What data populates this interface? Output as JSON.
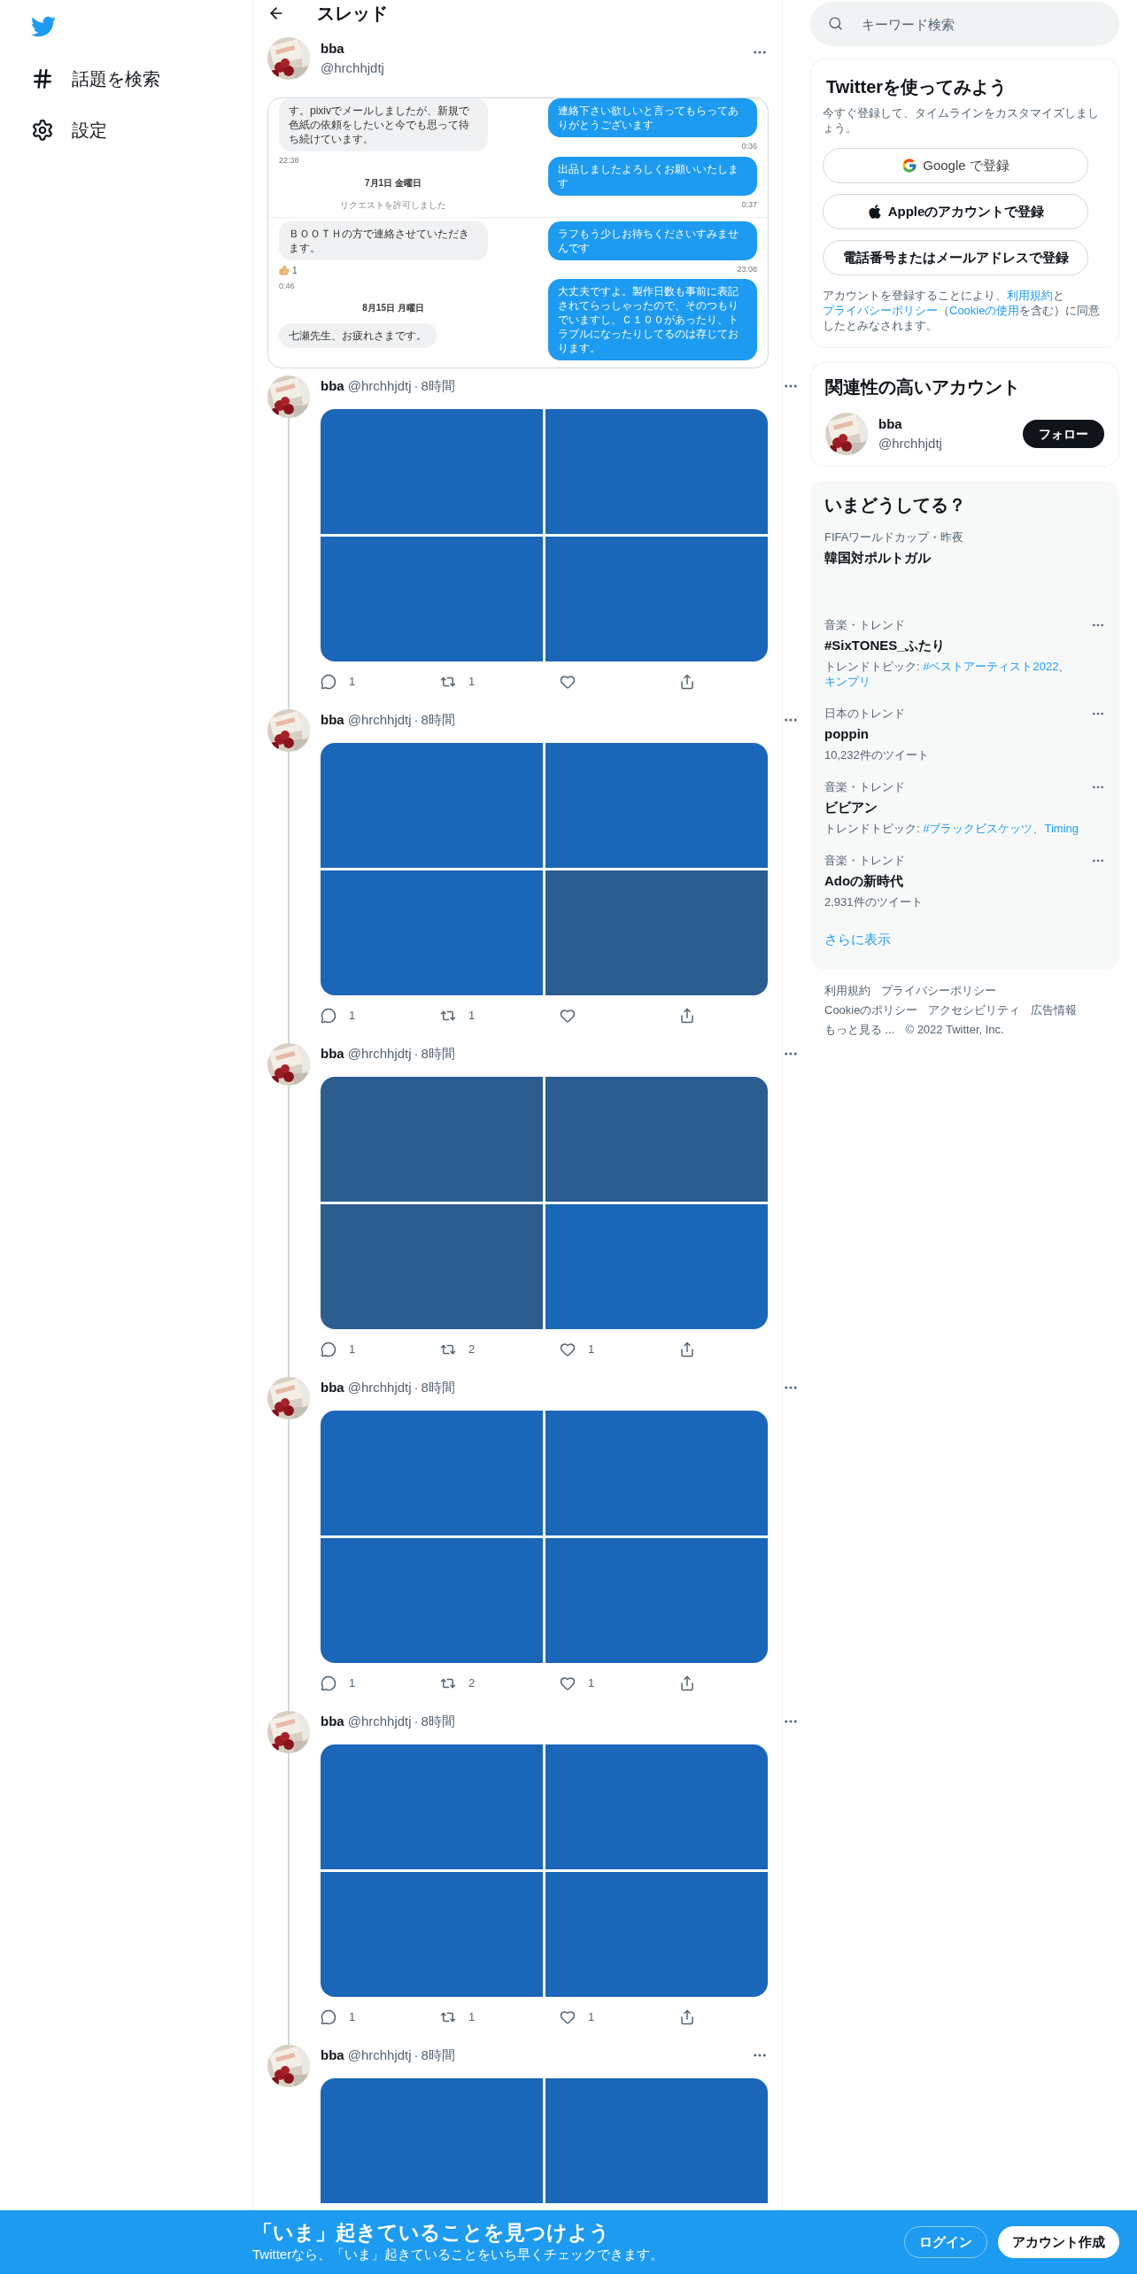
{
  "nav": {
    "items": [
      {
        "kind": "explore",
        "label": "話題を検索"
      },
      {
        "kind": "settings",
        "label": "設定"
      }
    ]
  },
  "header": {
    "title": "スレッド"
  },
  "main_tweet": {
    "name": "bba",
    "handle": "@hrchhjdtj",
    "screenshot": {
      "sections": [
        {
          "left": [
            {
              "kind": "bubble",
              "text": "す。pixivでメールしましたが、新規で色紙の依頼をしたいと今でも思って待ち続けています。"
            },
            {
              "kind": "time",
              "text": "22:38"
            },
            {
              "kind": "date",
              "text": "7月1日 金曜日"
            },
            {
              "kind": "notice",
              "text": "リクエストを許可しました"
            }
          ],
          "right": [
            {
              "kind": "bubble",
              "text": "連絡下さい欲しいと言ってもらってありがとうございます"
            },
            {
              "kind": "time",
              "text": "0:36"
            },
            {
              "kind": "bubble",
              "text": "出品しましたよろしくお願いいたします"
            },
            {
              "kind": "time",
              "text": "0:37"
            }
          ]
        },
        {
          "left": [
            {
              "kind": "bubble",
              "text": "ＢＯＯＴＨの方で連絡させていただきます。"
            },
            {
              "kind": "reaction",
              "text": "1"
            },
            {
              "kind": "time",
              "text": "0:46"
            },
            {
              "kind": "date",
              "text": "8月15日 月曜日"
            },
            {
              "kind": "bubble",
              "text": "七瀬先生、お疲れさまです。"
            }
          ],
          "right": [
            {
              "kind": "bubble",
              "text": "ラフもう少しお待ちくださいすみませんです"
            },
            {
              "kind": "time",
              "text": "23:08"
            },
            {
              "kind": "bubble",
              "text": "大丈夫ですよ。製作日数も事前に表記されてらっしゃったので、そのつもりでいますし、Ｃ１００があったり、トラブルになったりしてるのは存じております。"
            }
          ]
        }
      ]
    }
  },
  "replies": [
    {
      "name": "bba",
      "handle": "@hrchhjdtj",
      "separator": "·",
      "time": "8時間",
      "images": [
        {
          "color": "#1a66b8"
        },
        {
          "color": "#1a66b8"
        },
        {
          "color": "#1a66b8"
        },
        {
          "color": "#1a66b8"
        }
      ],
      "actions": [
        {
          "kind": "reply",
          "count": "1"
        },
        {
          "kind": "retweet",
          "count": "1"
        },
        {
          "kind": "like"
        },
        {
          "kind": "share"
        }
      ]
    },
    {
      "name": "bba",
      "handle": "@hrchhjdtj",
      "separator": "·",
      "time": "8時間",
      "images": [
        {
          "color": "#1a66b8"
        },
        {
          "color": "#1a66b8"
        },
        {
          "color": "#1a66b8"
        },
        {
          "color": "#2b5d8f"
        }
      ],
      "actions": [
        {
          "kind": "reply",
          "count": "1"
        },
        {
          "kind": "retweet",
          "count": "1"
        },
        {
          "kind": "like"
        },
        {
          "kind": "share"
        }
      ]
    },
    {
      "name": "bba",
      "handle": "@hrchhjdtj",
      "separator": "·",
      "time": "8時間",
      "images": [
        {
          "color": "#2b5d8f"
        },
        {
          "color": "#2b5d8f"
        },
        {
          "color": "#2b5d8f"
        },
        {
          "color": "#1a66b8"
        }
      ],
      "actions": [
        {
          "kind": "reply",
          "count": "1"
        },
        {
          "kind": "retweet",
          "count": "2"
        },
        {
          "kind": "like",
          "count": "1"
        },
        {
          "kind": "share"
        }
      ]
    },
    {
      "name": "bba",
      "handle": "@hrchhjdtj",
      "separator": "·",
      "time": "8時間",
      "images": [
        {
          "color": "#1a66b8"
        },
        {
          "color": "#1a66b8"
        },
        {
          "color": "#1a66b8"
        },
        {
          "color": "#1a66b8"
        }
      ],
      "actions": [
        {
          "kind": "reply",
          "count": "1"
        },
        {
          "kind": "retweet",
          "count": "2"
        },
        {
          "kind": "like",
          "count": "1"
        },
        {
          "kind": "share"
        }
      ]
    },
    {
      "name": "bba",
      "handle": "@hrchhjdtj",
      "separator": "·",
      "time": "8時間",
      "images": [
        {
          "color": "#1a66b8"
        },
        {
          "color": "#1a66b8"
        },
        {
          "color": "#1a66b8"
        },
        {
          "color": "#1a66b8"
        }
      ],
      "actions": [
        {
          "kind": "reply",
          "count": "1"
        },
        {
          "kind": "retweet",
          "count": "1"
        },
        {
          "kind": "like",
          "count": "1"
        },
        {
          "kind": "share"
        }
      ]
    },
    {
      "name": "bba",
      "handle": "@hrchhjdtj",
      "separator": "·",
      "time": "8時間",
      "images": [
        {
          "color": "#1a66b8"
        },
        {
          "color": "#1a66b8"
        }
      ]
    }
  ],
  "search": {
    "placeholder": "キーワード検索"
  },
  "signup": {
    "title": "Twitterを使ってみよう",
    "subtitle": "今すぐ登録して、タイムラインをカスタマイズしましょう。",
    "buttons": [
      {
        "kind": "google",
        "label": "Google で登録"
      },
      {
        "kind": "apple",
        "label": "Appleのアカウントで登録"
      },
      {
        "kind": "phone",
        "label": "電話番号またはメールアドレスで登録"
      }
    ],
    "legal": [
      {
        "text": "アカウントを登録することにより、",
        "link": false
      },
      {
        "text": "利用規約",
        "link": true
      },
      {
        "text": "と",
        "link": false
      },
      {
        "text": "プライバシーポリシー",
        "link": true
      },
      {
        "text": "（",
        "link": false
      },
      {
        "text": "Cookieの使用",
        "link": true
      },
      {
        "text": "を含む）に同意したとみなされます。",
        "link": false
      }
    ]
  },
  "related": {
    "title": "関連性の高いアカウント",
    "accounts": [
      {
        "name": "bba",
        "handle": "@hrchhjdtj",
        "button": "フォロー"
      }
    ]
  },
  "trends": {
    "title": "いまどうしてる？",
    "items": [
      {
        "category": "FIFAワールドカップ・昨夜",
        "title": "韓国対ポルトガル",
        "more": false
      },
      {
        "category": "音楽・トレンド",
        "title": "#SixTONES_ふたり",
        "more": true,
        "meta": [
          {
            "text": "トレンドトピック: ",
            "link": false
          },
          {
            "text": "#ベストアーティスト2022",
            "link": true
          },
          {
            "text": "、",
            "link": false
          },
          {
            "text": "キンプリ",
            "link": true
          }
        ]
      },
      {
        "category": "日本のトレンド",
        "title": "poppin",
        "more": true,
        "meta": [
          {
            "text": "10,232件のツイート",
            "link": false
          }
        ]
      },
      {
        "category": "音楽・トレンド",
        "title": "ビビアン",
        "more": true,
        "meta": [
          {
            "text": "トレンドトピック: ",
            "link": false
          },
          {
            "text": "#ブラックビスケッツ",
            "link": true
          },
          {
            "text": "、",
            "link": false
          },
          {
            "text": "Timing",
            "link": true
          }
        ]
      },
      {
        "category": "音楽・トレンド",
        "title": "Adoの新時代",
        "more": true,
        "meta": [
          {
            "text": "2,931件のツイート",
            "link": false
          }
        ]
      }
    ],
    "show_more": "さらに表示"
  },
  "footer": {
    "links": [
      "利用規約",
      "プライバシーポリシー",
      "Cookieのポリシー",
      "アクセシビリティ",
      "広告情報",
      "もっと見る ..."
    ],
    "copyright": "© 2022 Twitter, Inc."
  },
  "banner": {
    "title": "「いま」起きていることを見つけよう",
    "subtitle": "Twitterなら、「いま」起きていることをいち早くチェックできます。",
    "login": "ログイン",
    "signup": "アカウント作成"
  }
}
